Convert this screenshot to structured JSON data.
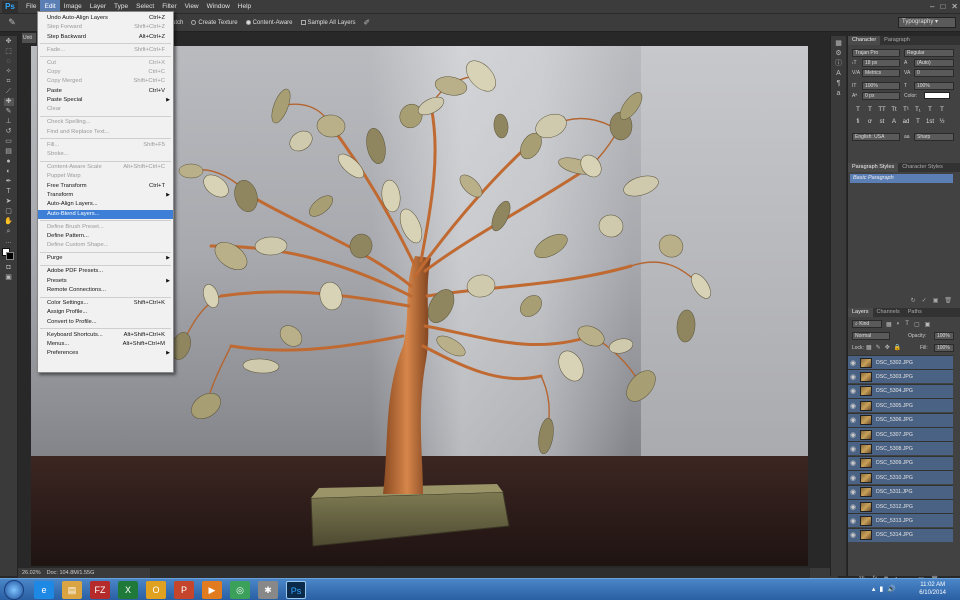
{
  "app": {
    "logo": "Ps"
  },
  "menubar": {
    "items": [
      "File",
      "Edit",
      "Image",
      "Layer",
      "Type",
      "Select",
      "Filter",
      "View",
      "Window",
      "Help"
    ],
    "active": "Edit",
    "window_controls": [
      "–",
      "□",
      "✕"
    ]
  },
  "options_bar": {
    "items": [
      "Patch",
      "Create Texture",
      "Content-Aware",
      "Sample All Layers"
    ],
    "workspace": "Typography"
  },
  "document": {
    "tab": "Unti"
  },
  "status": {
    "zoom": "26.02%",
    "doc": "Doc: 104.8M/1.55G"
  },
  "edit_menu": {
    "items": [
      {
        "label": "Undo Auto-Align Layers",
        "shortcut": "Ctrl+Z",
        "disabled": false
      },
      {
        "label": "Step Forward",
        "shortcut": "Shift+Ctrl+Z",
        "disabled": true
      },
      {
        "label": "Step Backward",
        "shortcut": "Alt+Ctrl+Z",
        "disabled": false
      },
      {
        "sep": true
      },
      {
        "label": "Fade...",
        "shortcut": "Shift+Ctrl+F",
        "disabled": true
      },
      {
        "sep": true
      },
      {
        "label": "Cut",
        "shortcut": "Ctrl+X",
        "disabled": true
      },
      {
        "label": "Copy",
        "shortcut": "Ctrl+C",
        "disabled": true
      },
      {
        "label": "Copy Merged",
        "shortcut": "Shift+Ctrl+C",
        "disabled": true
      },
      {
        "label": "Paste",
        "shortcut": "Ctrl+V",
        "disabled": false
      },
      {
        "label": "Paste Special",
        "shortcut": "",
        "disabled": false,
        "submenu": true
      },
      {
        "label": "Clear",
        "shortcut": "",
        "disabled": true
      },
      {
        "sep": true
      },
      {
        "label": "Check Spelling...",
        "shortcut": "",
        "disabled": true
      },
      {
        "label": "Find and Replace Text...",
        "shortcut": "",
        "disabled": true
      },
      {
        "sep": true
      },
      {
        "label": "Fill...",
        "shortcut": "Shift+F5",
        "disabled": true
      },
      {
        "label": "Stroke...",
        "shortcut": "",
        "disabled": true
      },
      {
        "sep": true
      },
      {
        "label": "Content-Aware Scale",
        "shortcut": "Alt+Shift+Ctrl+C",
        "disabled": true
      },
      {
        "label": "Puppet Warp",
        "shortcut": "",
        "disabled": true
      },
      {
        "label": "Free Transform",
        "shortcut": "Ctrl+T",
        "disabled": false
      },
      {
        "label": "Transform",
        "shortcut": "",
        "disabled": false,
        "submenu": true
      },
      {
        "label": "Auto-Align Layers...",
        "shortcut": "",
        "disabled": false
      },
      {
        "label": "Auto-Blend Layers...",
        "shortcut": "",
        "disabled": false,
        "highlighted": true
      },
      {
        "sep": true
      },
      {
        "label": "Define Brush Preset...",
        "shortcut": "",
        "disabled": true
      },
      {
        "label": "Define Pattern...",
        "shortcut": "",
        "disabled": false
      },
      {
        "label": "Define Custom Shape...",
        "shortcut": "",
        "disabled": true
      },
      {
        "sep": true
      },
      {
        "label": "Purge",
        "shortcut": "",
        "disabled": false,
        "submenu": true
      },
      {
        "sep": true
      },
      {
        "label": "Adobe PDF Presets...",
        "shortcut": "",
        "disabled": false
      },
      {
        "label": "Presets",
        "shortcut": "",
        "disabled": false,
        "submenu": true
      },
      {
        "label": "Remote Connections...",
        "shortcut": "",
        "disabled": false
      },
      {
        "sep": true
      },
      {
        "label": "Color Settings...",
        "shortcut": "Shift+Ctrl+K",
        "disabled": false
      },
      {
        "label": "Assign Profile...",
        "shortcut": "",
        "disabled": false
      },
      {
        "label": "Convert to Profile...",
        "shortcut": "",
        "disabled": false
      },
      {
        "sep": true
      },
      {
        "label": "Keyboard Shortcuts...",
        "shortcut": "Alt+Shift+Ctrl+K",
        "disabled": false
      },
      {
        "label": "Menus...",
        "shortcut": "Alt+Shift+Ctrl+M",
        "disabled": false
      },
      {
        "label": "Preferences",
        "shortcut": "",
        "disabled": false,
        "submenu": true
      }
    ]
  },
  "character_panel": {
    "tabs": [
      "Character",
      "Paragraph"
    ],
    "font_family": "Trajan Pro",
    "font_style": "Regular",
    "size": "18 px",
    "leading": "(Auto)",
    "kerning": "Metrics",
    "tracking": "0",
    "vscale": "100%",
    "hscale": "100%",
    "baseline": "0 px",
    "color_label": "Color:",
    "language": "English: USA",
    "aa_label": "aa",
    "antialias": "Sharp",
    "style_buttons": [
      "T",
      "T",
      "TT",
      "Tt",
      "T¹",
      "T₁",
      "T",
      "T"
    ],
    "opentype_buttons": [
      "fi",
      "ơ",
      "st",
      "A",
      "ad",
      "T",
      "1st",
      "½"
    ]
  },
  "paragraph_styles": {
    "tabs": [
      "Paragraph Styles",
      "Character Styles"
    ],
    "selected": "Basic Paragraph"
  },
  "layers_panel": {
    "tabs": [
      "Layers",
      "Channels",
      "Paths"
    ],
    "kind": "Kind",
    "blend_mode": "Normal",
    "opacity_label": "Opacity:",
    "opacity": "100%",
    "lock_label": "Lock:",
    "fill_label": "Fill:",
    "fill": "100%",
    "layers": [
      "DSC_5302.JPG",
      "DSC_5303.JPG",
      "DSC_5304.JPG",
      "DSC_5305.JPG",
      "DSC_5306.JPG",
      "DSC_5307.JPG",
      "DSC_5308.JPG",
      "DSC_5309.JPG",
      "DSC_5310.JPG",
      "DSC_5311.JPG",
      "DSC_5312.JPG",
      "DSC_5313.JPG",
      "DSC_5314.JPG"
    ]
  },
  "taskbar": {
    "time": "11:02 AM",
    "date": "6/10/2014",
    "apps": [
      "ie-icon",
      "explorer-icon",
      "filezilla-icon",
      "excel-icon",
      "outlook-icon",
      "powerpoint-icon",
      "media-icon",
      "chrome-icon",
      "bug-icon",
      "photoshop-icon"
    ]
  },
  "colors": {
    "accent": "#3d7fd6",
    "layer_selected": "#4a6283",
    "ps_blue": "#31a8ff"
  }
}
